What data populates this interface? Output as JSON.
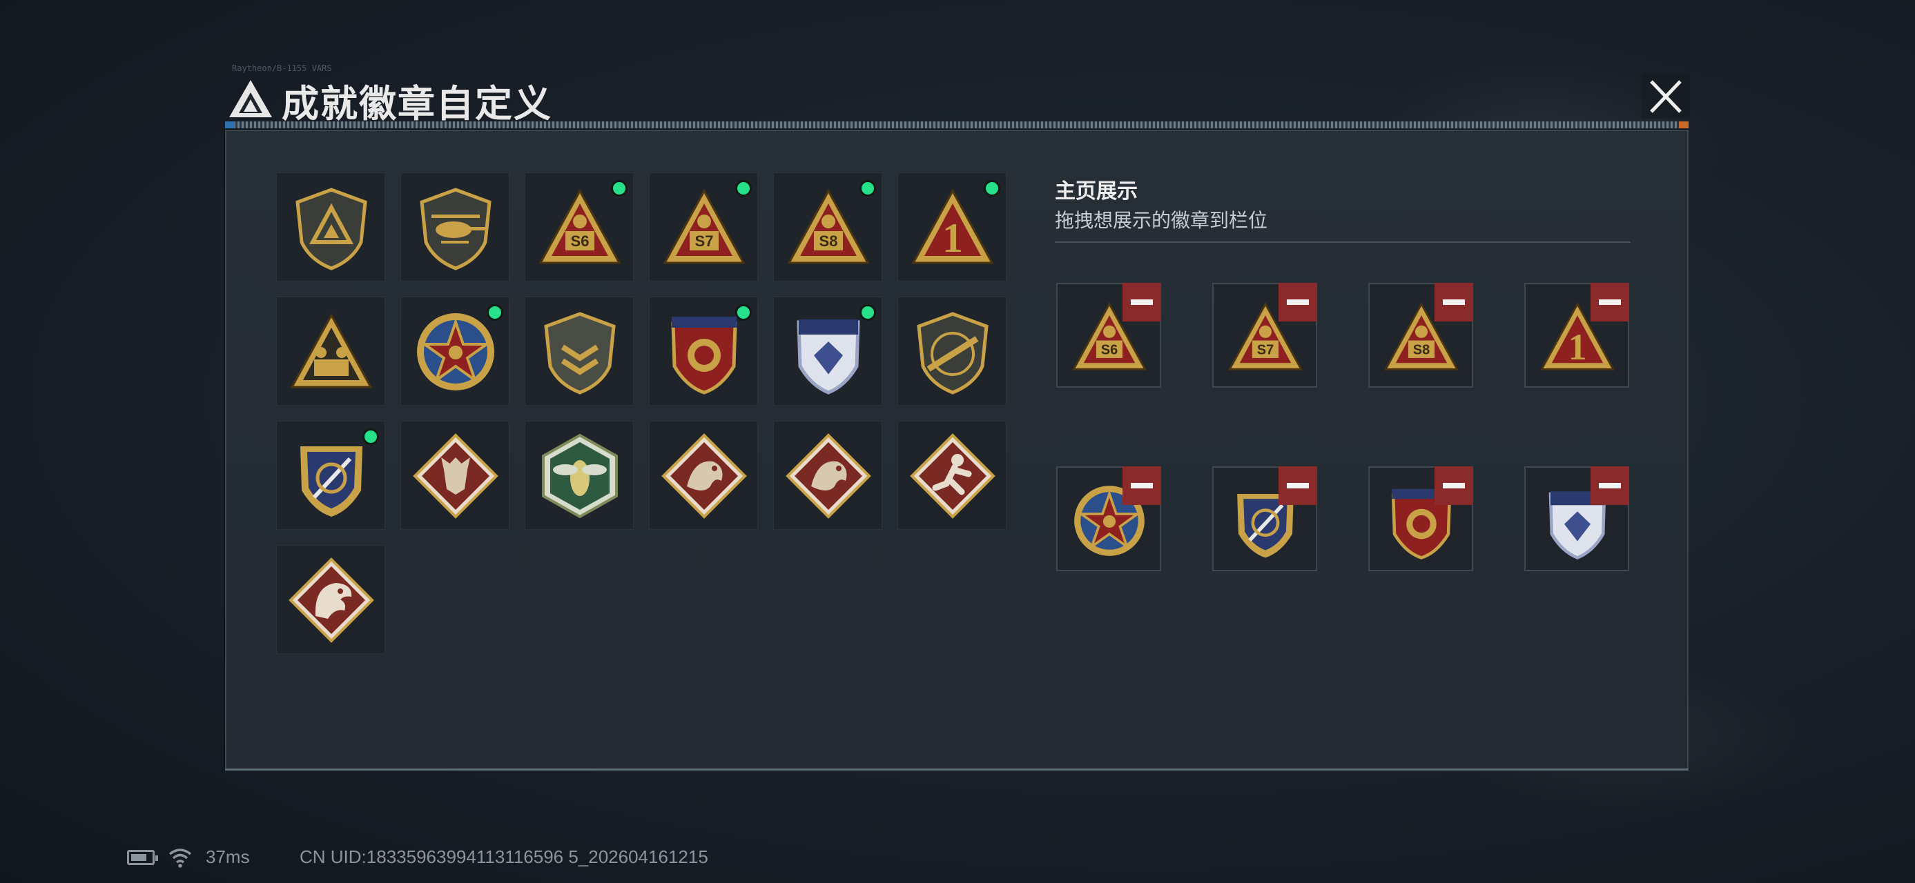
{
  "dialog": {
    "title": "成就徽章自定义",
    "title_tiny": "Raytheon/B-1155  VARS",
    "close_label": "×"
  },
  "inventory": {
    "badges": [
      {
        "name": "tri-logo-shield",
        "label": "",
        "has_new": false
      },
      {
        "name": "helicopter-shield",
        "label": "",
        "has_new": false
      },
      {
        "name": "s6-triangle",
        "label": "S6",
        "has_new": true
      },
      {
        "name": "s7-triangle",
        "label": "S7",
        "has_new": true
      },
      {
        "name": "s8-triangle",
        "label": "S8",
        "has_new": true
      },
      {
        "name": "rank-1-triangle",
        "label": "1",
        "has_new": true
      },
      {
        "name": "squad-triangle",
        "label": "",
        "has_new": false
      },
      {
        "name": "star-medal",
        "label": "",
        "has_new": true
      },
      {
        "name": "chevron-shield",
        "label": "",
        "has_new": false
      },
      {
        "name": "red-laurel-shield",
        "label": "",
        "has_new": true
      },
      {
        "name": "blue-diamond-shield",
        "label": "",
        "has_new": true
      },
      {
        "name": "rifle-shield",
        "label": "",
        "has_new": false
      },
      {
        "name": "gold-sword-shield",
        "label": "",
        "has_new": true
      },
      {
        "name": "wolf-diamond",
        "label": "",
        "has_new": false
      },
      {
        "name": "hornet-hexagon",
        "label": "",
        "has_new": false
      },
      {
        "name": "dragon-diamond-a",
        "label": "",
        "has_new": false
      },
      {
        "name": "dragon-diamond-b",
        "label": "",
        "has_new": false
      },
      {
        "name": "runner-diamond",
        "label": "",
        "has_new": false
      },
      {
        "name": "raptor-diamond",
        "label": "",
        "has_new": false
      }
    ]
  },
  "showcase": {
    "title": "主页展示",
    "subtitle": "拖拽想展示的徽章到栏位",
    "slots": [
      {
        "name": "s6-triangle",
        "label": "S6"
      },
      {
        "name": "s7-triangle",
        "label": "S7"
      },
      {
        "name": "s8-triangle",
        "label": "S8"
      },
      {
        "name": "rank-1-triangle",
        "label": "1"
      },
      {
        "name": "star-medal",
        "label": ""
      },
      {
        "name": "gold-sword-shield",
        "label": ""
      },
      {
        "name": "red-laurel-shield",
        "label": ""
      },
      {
        "name": "blue-diamond-shield",
        "label": ""
      }
    ]
  },
  "status_bar": {
    "battery_icon": "battery-icon",
    "wifi_icon": "wifi-icon",
    "ping": "37ms",
    "uid": "CN UID:18335963994113116596 5_202604161215"
  },
  "colors": {
    "new_dot": "#27e08a",
    "remove": "#8a2a2a",
    "gold": "#c9a247",
    "crimson": "#8e2020",
    "navy": "#2b3a6e"
  }
}
